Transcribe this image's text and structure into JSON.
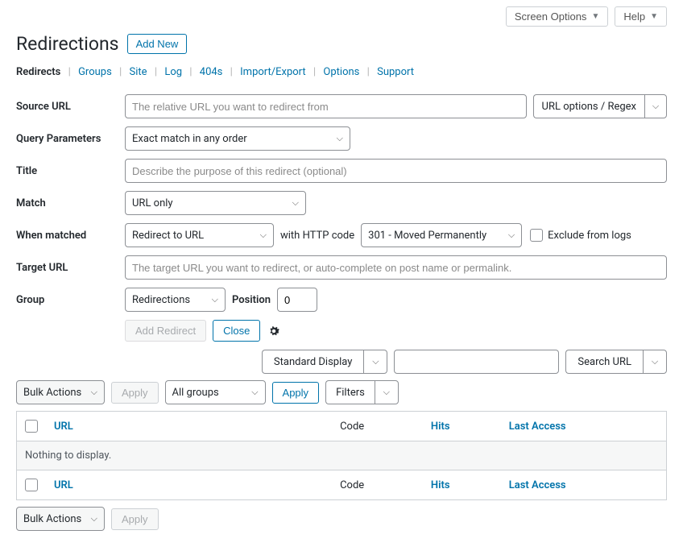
{
  "top": {
    "screen_options": "Screen Options",
    "help": "Help"
  },
  "header": {
    "title": "Redirections",
    "add_new": "Add New"
  },
  "tabs": {
    "redirects": "Redirects",
    "groups": "Groups",
    "site": "Site",
    "log": "Log",
    "fourzerofour": "404s",
    "import_export": "Import/Export",
    "options": "Options",
    "support": "Support"
  },
  "form": {
    "source_url_label": "Source URL",
    "source_url_placeholder": "The relative URL you want to redirect from",
    "url_options": "URL options / Regex",
    "query_params_label": "Query Parameters",
    "query_params_value": "Exact match in any order",
    "title_label": "Title",
    "title_placeholder": "Describe the purpose of this redirect (optional)",
    "match_label": "Match",
    "match_value": "URL only",
    "when_matched_label": "When matched",
    "when_matched_value": "Redirect to URL",
    "http_code_label": "with HTTP code",
    "http_code_value": "301 - Moved Permanently",
    "exclude_logs": "Exclude from logs",
    "target_url_label": "Target URL",
    "target_url_placeholder": "The target URL you want to redirect, or auto-complete on post name or permalink.",
    "group_label": "Group",
    "group_value": "Redirections",
    "position_label": "Position",
    "position_value": "0",
    "add_redirect": "Add Redirect",
    "close": "Close"
  },
  "display": {
    "standard": "Standard Display",
    "search_url": "Search URL"
  },
  "filters": {
    "bulk_actions": "Bulk Actions",
    "apply": "Apply",
    "all_groups": "All groups",
    "filters": "Filters"
  },
  "table": {
    "url": "URL",
    "code": "Code",
    "hits": "Hits",
    "last_access": "Last Access",
    "empty": "Nothing to display."
  }
}
